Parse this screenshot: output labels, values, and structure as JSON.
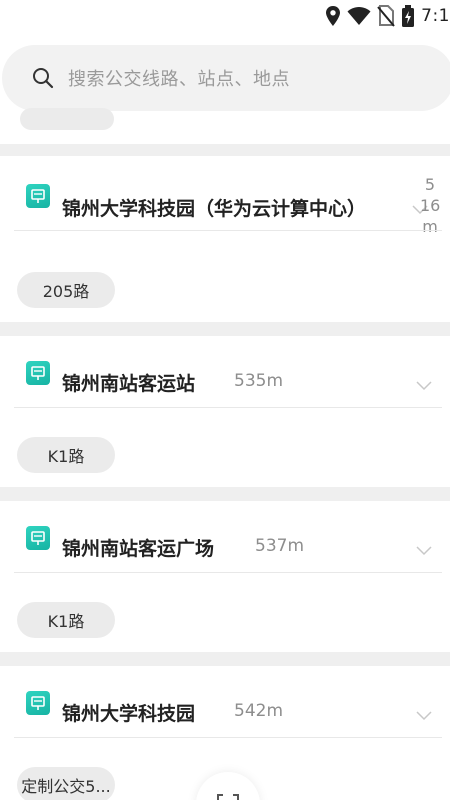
{
  "status_bar": {
    "time": "7:1",
    "icons": [
      "location-icon",
      "wifi-icon",
      "no-sim-icon",
      "battery-icon"
    ]
  },
  "search": {
    "placeholder": "搜索公交线路、站点、地点"
  },
  "stops": [
    {
      "name": "锦州大学科技园（华为云计算中心）",
      "distance": "516m",
      "distance_chars": [
        "5",
        "16",
        "m"
      ],
      "routes": [
        "205路"
      ]
    },
    {
      "name": "锦州南站客运站",
      "distance": "535m",
      "routes": [
        "K1路"
      ]
    },
    {
      "name": "锦州南站客运广场",
      "distance": "537m",
      "routes": [
        "K1路"
      ]
    },
    {
      "name": "锦州大学科技园",
      "distance": "542m",
      "routes": [
        "定制公交5..."
      ]
    }
  ],
  "colors": {
    "accent": "#1fc3b1",
    "background": "#efefef",
    "card": "#ffffff",
    "tag": "#ebebeb"
  }
}
